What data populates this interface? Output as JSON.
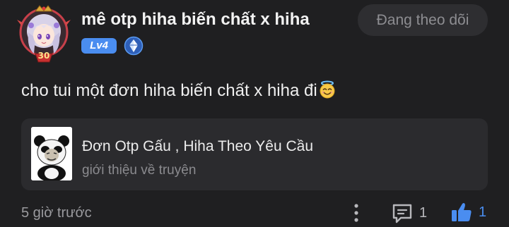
{
  "author": {
    "username": "mê otp hiha biến chất x hiha",
    "level": "Lv4",
    "avatar_icon": "anime-girl-avatar-icon",
    "avatar_frame_number": "30",
    "rank_icon": "blue-diamond-rank-icon"
  },
  "follow_button": {
    "label": "Đang theo dõi"
  },
  "post": {
    "text": "cho tui một đơn hiha biến chất x hiha đi",
    "emoji": "smiling-face-with-halo-icon"
  },
  "story_card": {
    "title": "Đơn Otp Gấu , Hiha Theo Yêu Cầu",
    "subtitle": "giới thiệu về truyện",
    "thumbnail_icon": "panda-meme-icon"
  },
  "footer": {
    "timestamp": "5 giờ trước",
    "comment_count": "1",
    "like_count": "1"
  },
  "colors": {
    "background": "#1f1f21",
    "card": "#2b2b2e",
    "accent": "#4a8df0",
    "muted_text": "#8b8b8f"
  }
}
